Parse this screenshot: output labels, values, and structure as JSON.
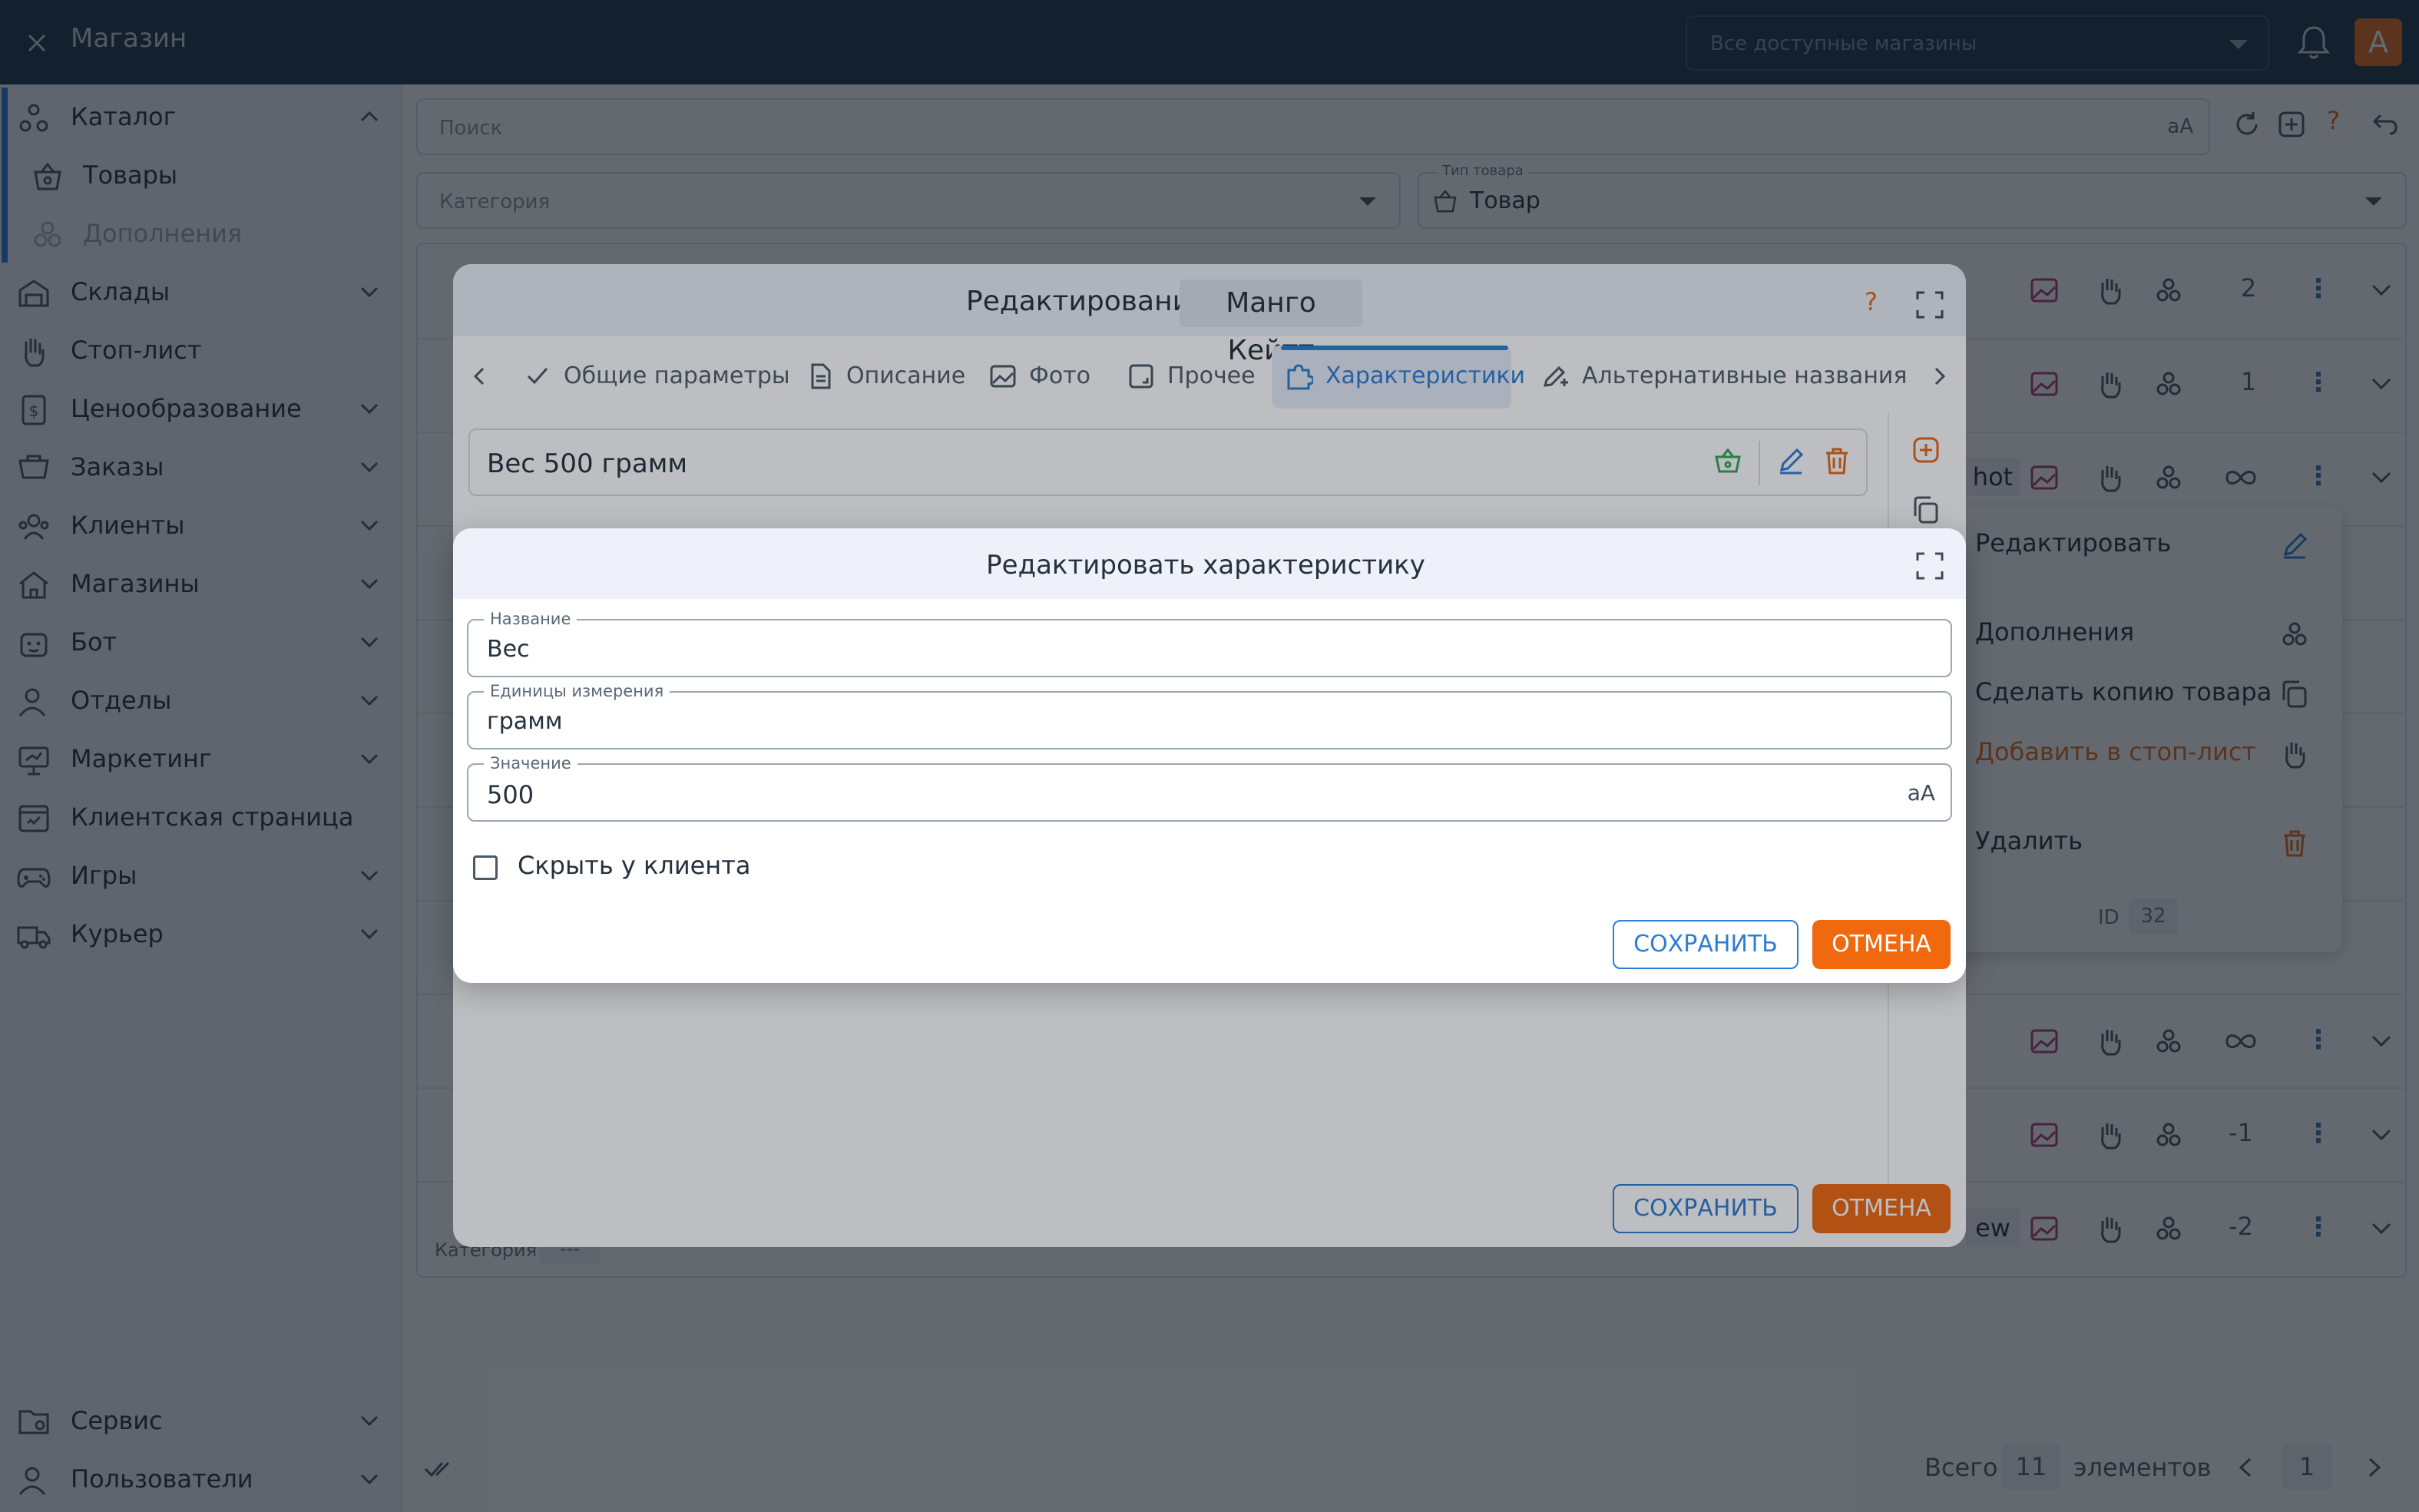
{
  "app": {
    "title": "Магазин",
    "store_select_placeholder": "Все доступные магазины",
    "avatar_letter": "A",
    "accent_color": "#2e7dd3",
    "cancel_color": "#f0690f"
  },
  "sidebar": {
    "items": [
      {
        "label": "Каталог",
        "icon": "catalog-icon"
      },
      {
        "label": "Товары",
        "icon": "basket-icon"
      },
      {
        "label": "Дополнения",
        "icon": "addons-icon"
      },
      {
        "label": "Склады",
        "icon": "warehouse-icon"
      },
      {
        "label": "Стоп-лист",
        "icon": "hand-icon"
      },
      {
        "label": "Ценообразование",
        "icon": "pricing-icon"
      },
      {
        "label": "Заказы",
        "icon": "orders-icon"
      },
      {
        "label": "Клиенты",
        "icon": "clients-icon"
      },
      {
        "label": "Магазины",
        "icon": "stores-icon"
      },
      {
        "label": "Бот",
        "icon": "bot-icon"
      },
      {
        "label": "Отделы",
        "icon": "departments-icon"
      },
      {
        "label": "Маркетинг",
        "icon": "marketing-icon"
      },
      {
        "label": "Клиентская страница",
        "icon": "client-page-icon"
      },
      {
        "label": "Игры",
        "icon": "gamepad-icon"
      },
      {
        "label": "Курьер",
        "icon": "courier-icon"
      }
    ],
    "bottom_items": [
      {
        "label": "Сервис",
        "icon": "service-icon"
      },
      {
        "label": "Пользователи",
        "icon": "users-icon"
      }
    ]
  },
  "toolbar": {
    "search_placeholder": "Поиск",
    "search_case_toggle": "aA",
    "help": "?",
    "category_placeholder": "Категория",
    "type_label": "Тип товара",
    "type_value": "Товар"
  },
  "table": {
    "row_counts": [
      "2",
      "1",
      "",
      "",
      "",
      "",
      "",
      "",
      "-1",
      "-2"
    ],
    "row_prefix": "Категория",
    "row_prefix_badge": "---",
    "cut_texts": [
      "hot",
      "ew"
    ]
  },
  "context_menu": {
    "edit": "Редактировать",
    "addons": "Дополнения",
    "copy": "Сделать копию товара",
    "stoplist": "Добавить в стоп-лист",
    "delete": "Удалить",
    "id_label": "ID",
    "id_value": "32"
  },
  "footer": {
    "total_label": "Всего",
    "total_value": "11",
    "total_suffix": "элементов",
    "page": "1"
  },
  "edit_dialog": {
    "title": "Редактирование",
    "product_name": "Манго Кейтт",
    "help": "?",
    "tabs": [
      {
        "label": "Общие параметры",
        "icon": "check-icon"
      },
      {
        "label": "Описание",
        "icon": "document-icon"
      },
      {
        "label": "Фото",
        "icon": "image-icon"
      },
      {
        "label": "Прочее",
        "icon": "other-icon"
      },
      {
        "label": "Характеристики",
        "icon": "puzzle-icon"
      },
      {
        "label": "Альтернативные названия",
        "icon": "rename-icon"
      }
    ],
    "active_tab": "Характеристики",
    "characteristic": "Вес 500 грамм",
    "save": "СОХРАНИТЬ",
    "cancel": "ОТМЕНА"
  },
  "char_dialog": {
    "title": "Редактировать характеристику",
    "name_label": "Название",
    "name_value": "Вес",
    "unit_label": "Единицы измерения",
    "unit_value": "грамм",
    "value_label": "Значение",
    "value_value": "500",
    "value_toggle": "aA",
    "hide_label": "Скрыть у клиента",
    "hide_checked": false,
    "save": "СОХРАНИТЬ",
    "cancel": "ОТМЕНА"
  }
}
